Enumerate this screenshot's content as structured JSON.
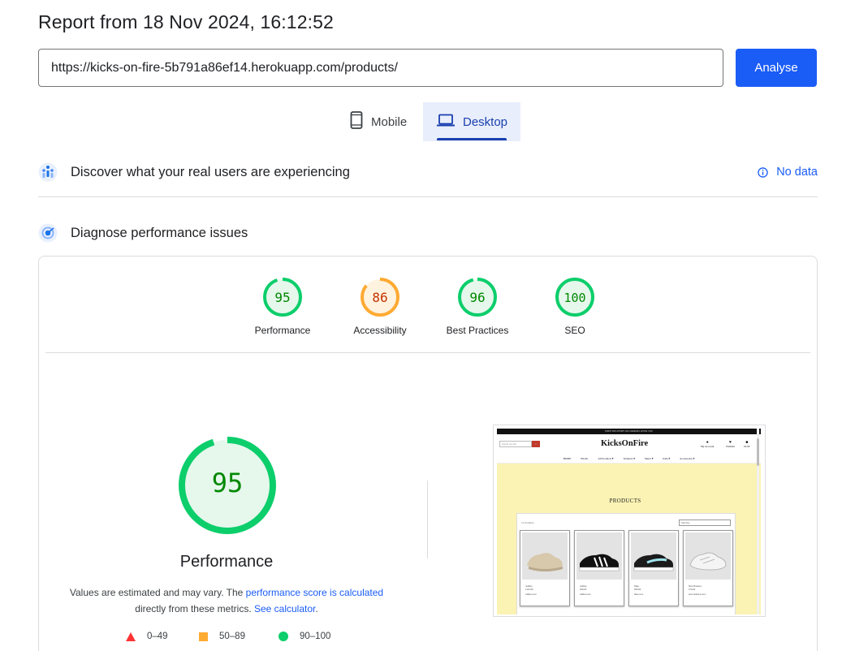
{
  "header": {
    "title": "Report from 18 Nov 2024, 16:12:52"
  },
  "url_bar": {
    "value": "https://kicks-on-fire-5b791a86ef14.herokuapp.com/products/",
    "analyse_label": "Analyse"
  },
  "device_tabs": [
    {
      "label": "Mobile",
      "icon": "smartphone-icon",
      "selected": false
    },
    {
      "label": "Desktop",
      "icon": "laptop-icon",
      "selected": true
    }
  ],
  "real_users": {
    "title": "Discover what your real users are experiencing",
    "status": "No data",
    "icon": "crux-icon"
  },
  "diagnose": {
    "title": "Diagnose performance issues",
    "icon": "lighthouse-icon"
  },
  "scores": [
    {
      "label": "Performance",
      "value": 95,
      "value_text": "95",
      "rating": "good"
    },
    {
      "label": "Accessibility",
      "value": 86,
      "value_text": "86",
      "rating": "average"
    },
    {
      "label": "Best Practices",
      "value": 96,
      "value_text": "96",
      "rating": "good"
    },
    {
      "label": "SEO",
      "value": 100,
      "value_text": "100",
      "rating": "good"
    }
  ],
  "performance": {
    "score": 95,
    "score_text": "95",
    "title": "Performance",
    "desc_prefix": "Values are estimated and may vary. The ",
    "desc_link1": "performance score is calculated",
    "desc_middle": "directly from these metrics. ",
    "desc_link2": "See calculator",
    "desc_suffix": "."
  },
  "legend": [
    {
      "range": "0–49",
      "shape": "triangle",
      "color": "#ff3333"
    },
    {
      "range": "50–89",
      "shape": "square",
      "color": "#ffaa33"
    },
    {
      "range": "90–100",
      "shape": "circle",
      "color": "#0cce6b"
    }
  ],
  "colors": {
    "good": "#0cce6b",
    "good_text": "#008800",
    "good_fill": "#e6f7ec",
    "average": "#ffaa33",
    "average_text": "#c33300",
    "average_fill": "#fff3e0",
    "accent": "#1a5cf6"
  },
  "screenshot": {
    "banner": "FREE DELIVERY ON ORDERS OVER £50!",
    "search_placeholder": "Search our site",
    "logo": "KicksOnFire",
    "account_items": [
      {
        "icon": "user-icon",
        "label": "My Account"
      },
      {
        "icon": "heart-icon",
        "label": "Wishlist"
      },
      {
        "icon": "bag-icon",
        "label": "£0.00"
      }
    ],
    "nav": [
      "HOME",
      "BLOG",
      "All Products ▾",
      "Women's ▾",
      "Men's ▾",
      "Kids ▾",
      "Accessories ▾"
    ],
    "page_title": "PRODUCTS",
    "product_count": "12 Products",
    "sort_label": "Sort by...",
    "products": [
      {
        "brand": "Adidas",
        "price": "£110.00",
        "category": "adidas-race"
      },
      {
        "brand": "Adidas",
        "price": "£90.00",
        "category": "adidas-race"
      },
      {
        "brand": "Nike",
        "price": "£80.00",
        "category": "nike-race"
      },
      {
        "brand": "New Balance",
        "price": "£70.00",
        "category": "new-balance-race"
      }
    ]
  }
}
